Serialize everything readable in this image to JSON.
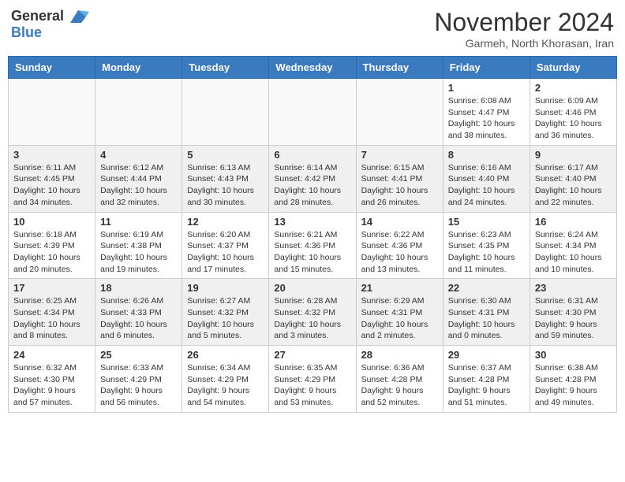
{
  "logo": {
    "general": "General",
    "blue": "Blue"
  },
  "title": {
    "month": "November 2024",
    "location": "Garmeh, North Khorasan, Iran"
  },
  "weekdays": [
    "Sunday",
    "Monday",
    "Tuesday",
    "Wednesday",
    "Thursday",
    "Friday",
    "Saturday"
  ],
  "weeks": [
    [
      {
        "day": "",
        "info": ""
      },
      {
        "day": "",
        "info": ""
      },
      {
        "day": "",
        "info": ""
      },
      {
        "day": "",
        "info": ""
      },
      {
        "day": "",
        "info": ""
      },
      {
        "day": "1",
        "info": "Sunrise: 6:08 AM\nSunset: 4:47 PM\nDaylight: 10 hours and 38 minutes."
      },
      {
        "day": "2",
        "info": "Sunrise: 6:09 AM\nSunset: 4:46 PM\nDaylight: 10 hours and 36 minutes."
      }
    ],
    [
      {
        "day": "3",
        "info": "Sunrise: 6:11 AM\nSunset: 4:45 PM\nDaylight: 10 hours and 34 minutes."
      },
      {
        "day": "4",
        "info": "Sunrise: 6:12 AM\nSunset: 4:44 PM\nDaylight: 10 hours and 32 minutes."
      },
      {
        "day": "5",
        "info": "Sunrise: 6:13 AM\nSunset: 4:43 PM\nDaylight: 10 hours and 30 minutes."
      },
      {
        "day": "6",
        "info": "Sunrise: 6:14 AM\nSunset: 4:42 PM\nDaylight: 10 hours and 28 minutes."
      },
      {
        "day": "7",
        "info": "Sunrise: 6:15 AM\nSunset: 4:41 PM\nDaylight: 10 hours and 26 minutes."
      },
      {
        "day": "8",
        "info": "Sunrise: 6:16 AM\nSunset: 4:40 PM\nDaylight: 10 hours and 24 minutes."
      },
      {
        "day": "9",
        "info": "Sunrise: 6:17 AM\nSunset: 4:40 PM\nDaylight: 10 hours and 22 minutes."
      }
    ],
    [
      {
        "day": "10",
        "info": "Sunrise: 6:18 AM\nSunset: 4:39 PM\nDaylight: 10 hours and 20 minutes."
      },
      {
        "day": "11",
        "info": "Sunrise: 6:19 AM\nSunset: 4:38 PM\nDaylight: 10 hours and 19 minutes."
      },
      {
        "day": "12",
        "info": "Sunrise: 6:20 AM\nSunset: 4:37 PM\nDaylight: 10 hours and 17 minutes."
      },
      {
        "day": "13",
        "info": "Sunrise: 6:21 AM\nSunset: 4:36 PM\nDaylight: 10 hours and 15 minutes."
      },
      {
        "day": "14",
        "info": "Sunrise: 6:22 AM\nSunset: 4:36 PM\nDaylight: 10 hours and 13 minutes."
      },
      {
        "day": "15",
        "info": "Sunrise: 6:23 AM\nSunset: 4:35 PM\nDaylight: 10 hours and 11 minutes."
      },
      {
        "day": "16",
        "info": "Sunrise: 6:24 AM\nSunset: 4:34 PM\nDaylight: 10 hours and 10 minutes."
      }
    ],
    [
      {
        "day": "17",
        "info": "Sunrise: 6:25 AM\nSunset: 4:34 PM\nDaylight: 10 hours and 8 minutes."
      },
      {
        "day": "18",
        "info": "Sunrise: 6:26 AM\nSunset: 4:33 PM\nDaylight: 10 hours and 6 minutes."
      },
      {
        "day": "19",
        "info": "Sunrise: 6:27 AM\nSunset: 4:32 PM\nDaylight: 10 hours and 5 minutes."
      },
      {
        "day": "20",
        "info": "Sunrise: 6:28 AM\nSunset: 4:32 PM\nDaylight: 10 hours and 3 minutes."
      },
      {
        "day": "21",
        "info": "Sunrise: 6:29 AM\nSunset: 4:31 PM\nDaylight: 10 hours and 2 minutes."
      },
      {
        "day": "22",
        "info": "Sunrise: 6:30 AM\nSunset: 4:31 PM\nDaylight: 10 hours and 0 minutes."
      },
      {
        "day": "23",
        "info": "Sunrise: 6:31 AM\nSunset: 4:30 PM\nDaylight: 9 hours and 59 minutes."
      }
    ],
    [
      {
        "day": "24",
        "info": "Sunrise: 6:32 AM\nSunset: 4:30 PM\nDaylight: 9 hours and 57 minutes."
      },
      {
        "day": "25",
        "info": "Sunrise: 6:33 AM\nSunset: 4:29 PM\nDaylight: 9 hours and 56 minutes."
      },
      {
        "day": "26",
        "info": "Sunrise: 6:34 AM\nSunset: 4:29 PM\nDaylight: 9 hours and 54 minutes."
      },
      {
        "day": "27",
        "info": "Sunrise: 6:35 AM\nSunset: 4:29 PM\nDaylight: 9 hours and 53 minutes."
      },
      {
        "day": "28",
        "info": "Sunrise: 6:36 AM\nSunset: 4:28 PM\nDaylight: 9 hours and 52 minutes."
      },
      {
        "day": "29",
        "info": "Sunrise: 6:37 AM\nSunset: 4:28 PM\nDaylight: 9 hours and 51 minutes."
      },
      {
        "day": "30",
        "info": "Sunrise: 6:38 AM\nSunset: 4:28 PM\nDaylight: 9 hours and 49 minutes."
      }
    ]
  ]
}
